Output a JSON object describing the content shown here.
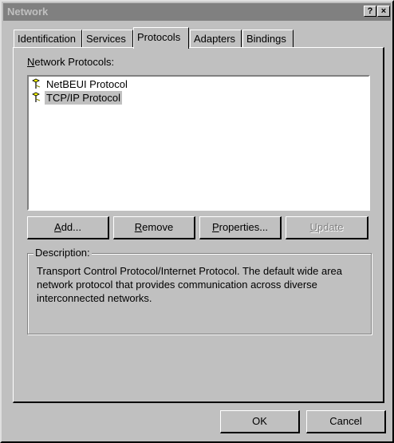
{
  "window": {
    "title": "Network",
    "help_button": "?",
    "close_button": "×"
  },
  "tabs": [
    {
      "label": "Identification",
      "active": false
    },
    {
      "label": "Services",
      "active": false
    },
    {
      "label": "Protocols",
      "active": true
    },
    {
      "label": "Adapters",
      "active": false
    },
    {
      "label": "Bindings",
      "active": false
    }
  ],
  "protocols": {
    "label_accel": "N",
    "label_rest": "etwork Protocols:",
    "items": [
      {
        "label": "NetBEUI Protocol",
        "icon": "network-protocol-icon",
        "selected": false
      },
      {
        "label": "TCP/IP Protocol",
        "icon": "network-protocol-icon",
        "selected": true
      }
    ]
  },
  "buttons": {
    "add": {
      "accel": "A",
      "rest": "dd..."
    },
    "remove": {
      "accel": "R",
      "rest": "emove"
    },
    "properties": {
      "accel": "P",
      "rest": "roperties..."
    },
    "update": {
      "accel": "U",
      "rest": "pdate"
    }
  },
  "description": {
    "label": "Description:",
    "text": "Transport Control Protocol/Internet Protocol. The default wide area network protocol that provides communication across diverse interconnected networks."
  },
  "footer": {
    "ok": "OK",
    "cancel": "Cancel"
  },
  "colors": {
    "face": "#c0c0c0",
    "titlebar_inactive": "#808080",
    "selection": "#c0c0c0"
  }
}
